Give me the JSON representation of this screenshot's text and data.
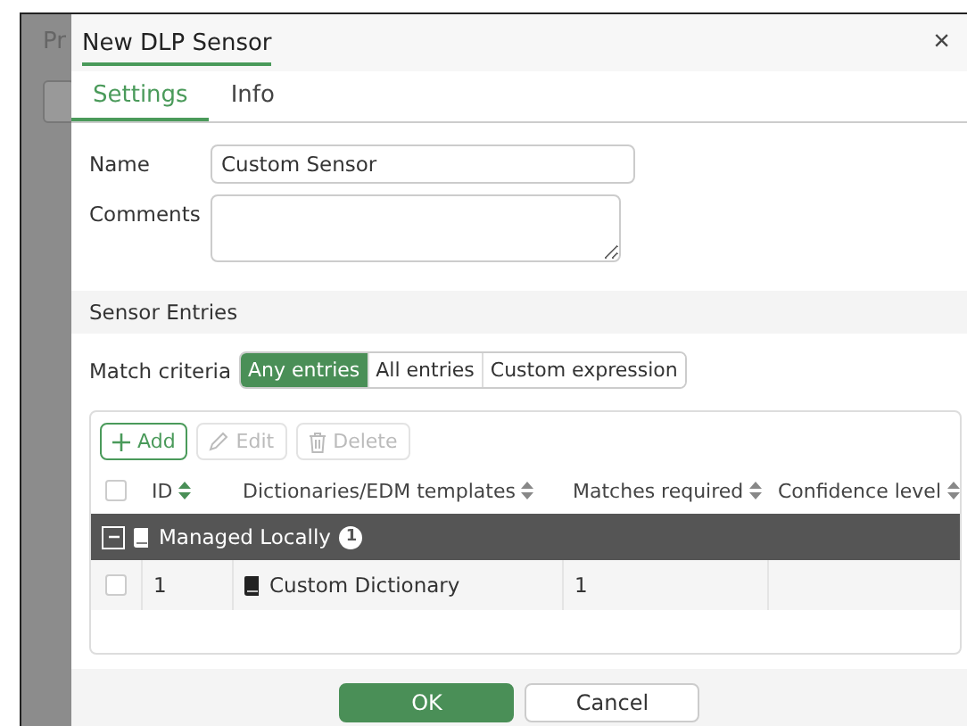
{
  "background": {
    "title": "Pr"
  },
  "dialog": {
    "title": "New DLP Sensor",
    "close": "×"
  },
  "tabs": [
    {
      "label": "Settings",
      "selected": true
    },
    {
      "label": "Info",
      "selected": false
    }
  ],
  "form": {
    "name": {
      "label": "Name",
      "value": "Custom Sensor"
    },
    "comments": {
      "label": "Comments"
    }
  },
  "section": {
    "title": "Sensor Entries"
  },
  "match_criteria": {
    "label": "Match criteria",
    "options": [
      {
        "label": "Any entries",
        "selected": true
      },
      {
        "label": "All entries",
        "selected": false
      },
      {
        "label": "Custom expression",
        "selected": false
      }
    ]
  },
  "toolbar": [
    {
      "label": "Add",
      "kind": "add",
      "disabled": false
    },
    {
      "label": "Edit",
      "kind": "edit",
      "disabled": true
    },
    {
      "label": "Delete",
      "kind": "delete",
      "disabled": true
    }
  ],
  "table": {
    "select_all": {
      "checked": false
    },
    "columns": [
      "ID",
      "Dictionaries/EDM templates",
      "Matches required",
      "Confidence level"
    ],
    "groups": [
      {
        "label": "Managed Locally",
        "count": "1",
        "expanded": true,
        "rows": [
          {
            "checked": false,
            "id": "1",
            "name": "Custom Dictionary",
            "matches": "1"
          }
        ]
      }
    ]
  },
  "buttons": [
    {
      "label": "OK",
      "kind": "primary"
    },
    {
      "label": "Cancel",
      "kind": "secondary"
    }
  ]
}
